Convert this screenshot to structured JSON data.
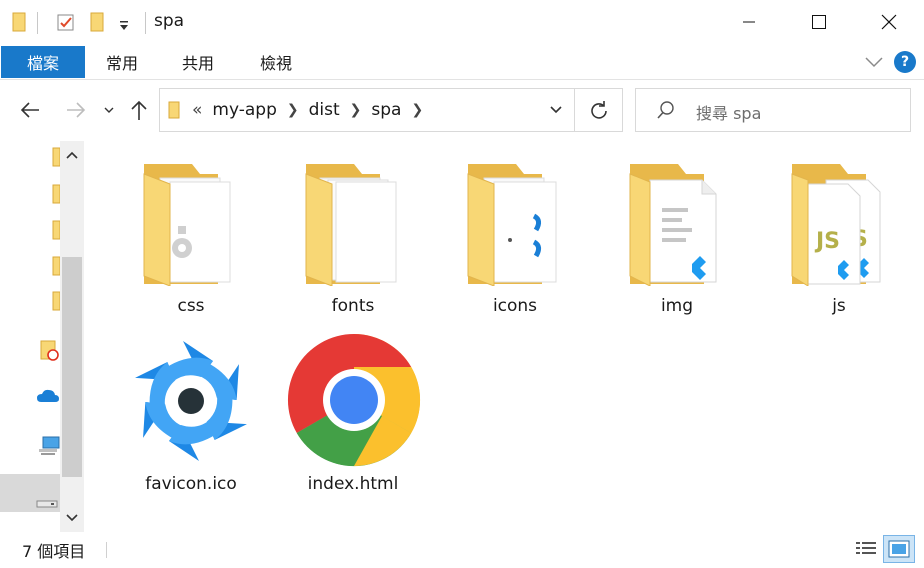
{
  "window": {
    "title": "spa"
  },
  "ribbon": {
    "tabs": [
      {
        "label": "檔案",
        "active": true
      },
      {
        "label": "常用"
      },
      {
        "label": "共用"
      },
      {
        "label": "檢視"
      }
    ],
    "help_label": "?"
  },
  "navigation": {
    "breadcrumb_prefix": "«",
    "breadcrumbs": [
      "my-app",
      "dist",
      "spa"
    ],
    "search_placeholder": "搜尋 spa"
  },
  "items": [
    {
      "name": "css",
      "kind": "folder"
    },
    {
      "name": "fonts",
      "kind": "folder"
    },
    {
      "name": "icons",
      "kind": "folder"
    },
    {
      "name": "img",
      "kind": "folder"
    },
    {
      "name": "js",
      "kind": "folder"
    },
    {
      "name": "favicon.ico",
      "kind": "icon-file"
    },
    {
      "name": "index.html",
      "kind": "chrome-html"
    }
  ],
  "statusbar": {
    "item_count": "7 個項目"
  },
  "colors": {
    "accent": "#1979ca",
    "folder": "#f8d775",
    "folder_dark": "#e8b84a"
  }
}
